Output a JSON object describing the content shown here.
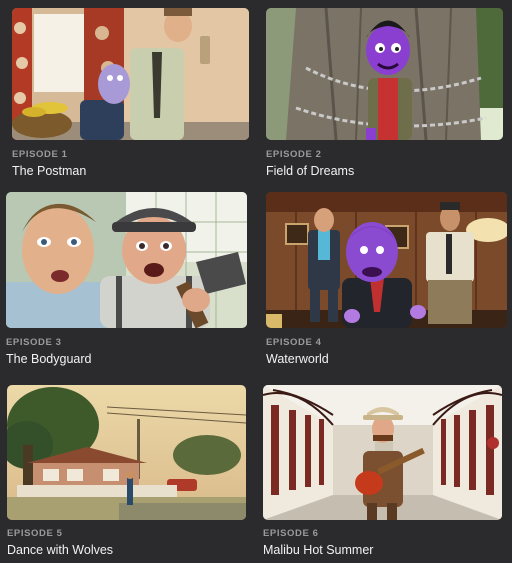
{
  "episodes": [
    {
      "label": "EPISODE 1",
      "title": "The Postman"
    },
    {
      "label": "EPISODE 2",
      "title": "Field of Dreams"
    },
    {
      "label": "EPISODE 3",
      "title": "The Bodyguard"
    },
    {
      "label": "EPISODE 4",
      "title": "Waterworld"
    },
    {
      "label": "EPISODE 5",
      "title": "Dance with Wolves"
    },
    {
      "label": "EPISODE 6",
      "title": "Malibu Hot Summer"
    }
  ]
}
